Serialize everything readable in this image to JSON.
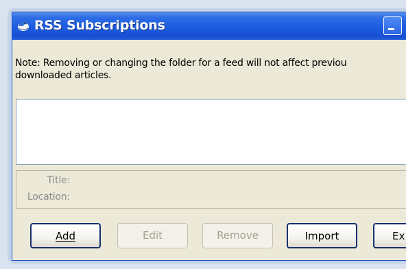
{
  "window": {
    "title": "RSS Subscriptions"
  },
  "note": {
    "line1": "Note: Removing or changing the folder for a feed will not affect previou",
    "line2": "downloaded articles."
  },
  "details": {
    "title_label": "Title:",
    "location_label": "Location:"
  },
  "buttons": {
    "add": "Add",
    "edit": "Edit",
    "remove": "Remove",
    "import": "Import",
    "export_partial": "Ex"
  },
  "colors": {
    "titlebar": "#1c5be0",
    "window_bg": "#ece9d8",
    "frame_bg": "#c3d3e8"
  }
}
